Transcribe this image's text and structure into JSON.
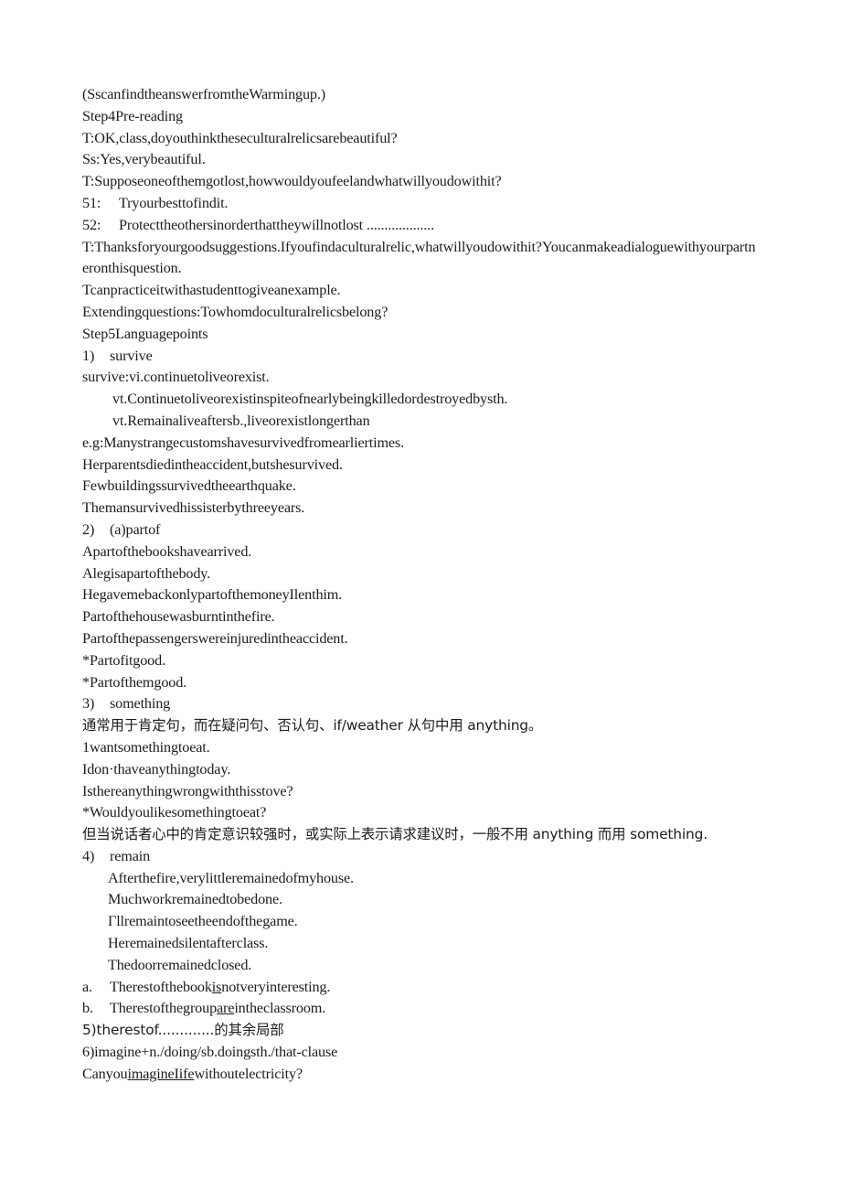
{
  "document": {
    "page_background": "#ffffff",
    "text_color": "#1c1c1c",
    "lines": {
      "l01": "(SscanfindtheanswerfromtheWarmingup.)",
      "l02": "Step4Pre-reading",
      "l03": "T:OK,class,doyouthinktheseculturalrelicsarebeautiful?",
      "l04": "Ss:Yes,verybeautiful.",
      "l05": "T:Supposeoneofthemgotlost,howwouldyoufeelandwhatwillyoudowithit?",
      "l06_label": "51:",
      "l06_text": "Tryourbesttofindit.",
      "l07_label": "52:",
      "l07_text": "Protecttheothersinorderthattheywillnotlost ...................",
      "l08": "T:Thanksforyourgoodsuggestions.Ifyoufindaculturalrelic,whatwillyoudowithit?Youcanmakeadialoguewithyourpartneronthisquestion.",
      "l09": "Tcanpracticeitwithastudenttogiveanexample.",
      "l10": "Extendingquestions:Towhomdoculturalrelicsbelong?",
      "l11": "Step5Languagepoints",
      "l12_label": "1)",
      "l12_text": "survive",
      "l13": "survive:vi.continuetoliveorexist.",
      "l14": "vt.Continuetoliveorexistinspiteofnearlybeingkilledordestroyedbysth.",
      "l15": "vt.Remainaliveaftersb.,liveorexistlongerthan",
      "l16": "e.g:Manystrangecustomshavesurvivedfromearliertimes.",
      "l17": "Herparentsdiedintheaccident,butshesurvived.",
      "l18": "Fewbuildingssurvivedtheearthquake.",
      "l19": "Themansurvivedhissisterbythreeyears.",
      "l20_label": "2)",
      "l20_text": "(a)partof",
      "l21": "Apartofthebookshavearrived.",
      "l22": "Alegisapartofthebody.",
      "l23": "HegavemebackonlypartofthemoneyIlenthim.",
      "l24": "Partofthehousewasburntinthefire.",
      "l25": "Partofthepassengerswereinjuredintheaccident.",
      "l26": "*Partofitgood.",
      "l27": "*Partofthemgood.",
      "l28_label": "3)",
      "l28_text": "something",
      "l29": "通常用于肯定句，而在疑问句、否认句、if/weather 从句中用 anything。",
      "l30": "1wantsomethingtoeat.",
      "l31": "Idon·thaveanythingtoday.",
      "l32": "Isthereanythingwrongwiththisstove?",
      "l33": "*Wouldyoulikesomethingtoeat?",
      "l34": "但当说话者心中的肯定意识较强时，或实际上表示请求建议时，一般不用 anything 而用 something.",
      "l35_label": "4)",
      "l35_text": "remain",
      "l36": "Afterthefire,verylittleremainedofmyhouse.",
      "l37": "Muchworkremainedtobedone.",
      "l38": "Γllremaintoseetheendofthegame.",
      "l39": "Heremainedsilentafterclass.",
      "l40": "Thedoorremainedclosed.",
      "l41_label": "a.",
      "l41_part1": "Therestofthebook",
      "l41_underlined": "is",
      "l41_part2": "notveryinteresting.",
      "l42_label": "b.",
      "l42_part1": "Therestofthegroup",
      "l42_underlined": "are",
      "l42_part2": "intheclassroom.",
      "l43": "5)therestof.............的其余局部",
      "l44": "6)imagine+n./doing/sb.doingsth./that-clause",
      "l45_part1": "Canyou",
      "l45_underlined": "imagineIife",
      "l45_part2": "withoutelectricity?"
    }
  }
}
